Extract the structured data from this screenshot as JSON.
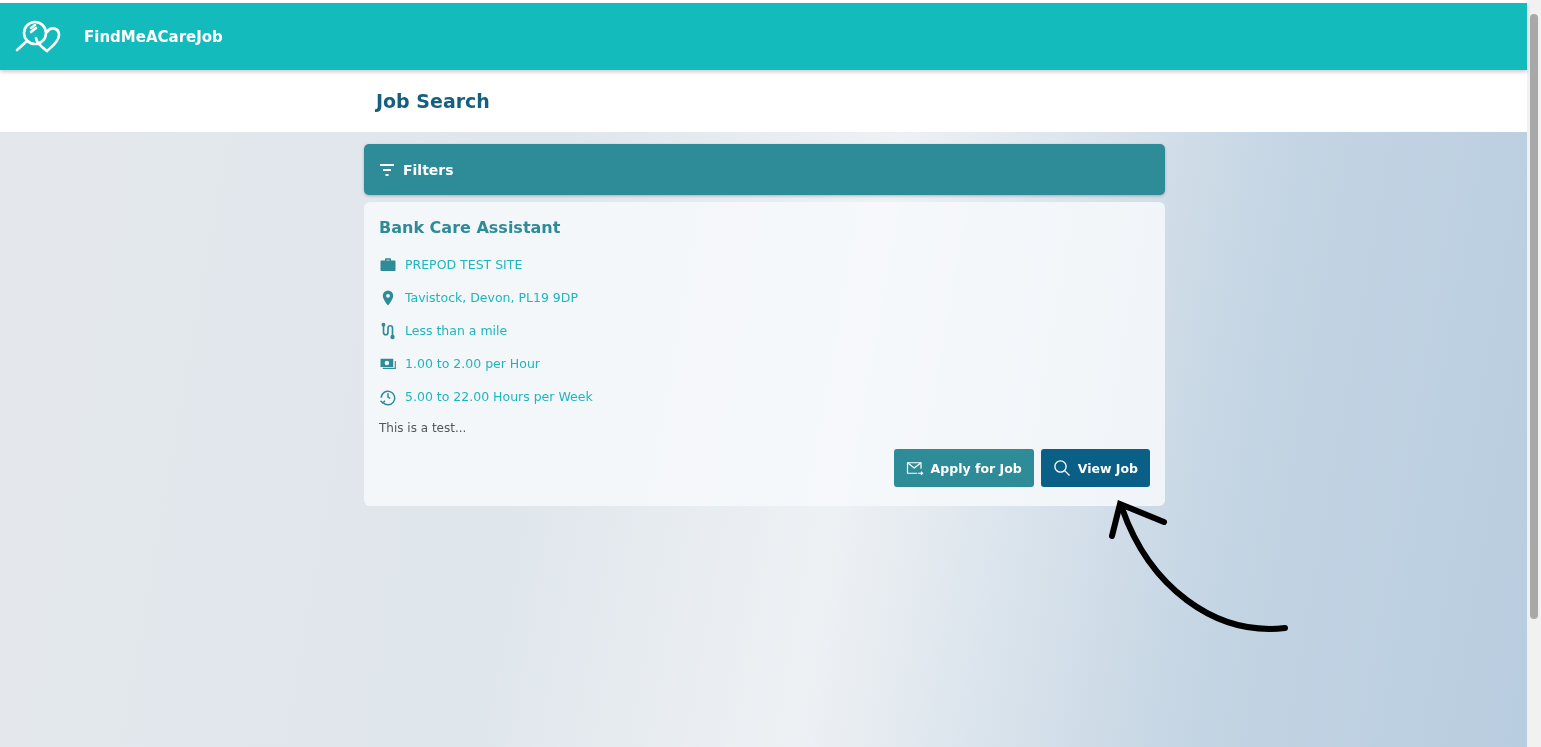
{
  "header": {
    "brand": "FindMeACareJob"
  },
  "page_title": "Job Search",
  "filters": {
    "label": "Filters"
  },
  "job": {
    "title": "Bank Care Assistant",
    "details": [
      {
        "kind": "company",
        "text": "PREPOD TEST SITE"
      },
      {
        "kind": "location",
        "text": "Tavistock, Devon, PL19 9DP"
      },
      {
        "kind": "distance",
        "text": "Less than a mile"
      },
      {
        "kind": "pay",
        "text": "1.00 to 2.00 per Hour"
      },
      {
        "kind": "hours",
        "text": "5.00 to 22.00 Hours per Week"
      }
    ],
    "summary": "This is a test...",
    "buttons": [
      {
        "kind": "apply",
        "label": "Apply for Job"
      },
      {
        "kind": "view",
        "label": "View Job"
      }
    ]
  }
}
